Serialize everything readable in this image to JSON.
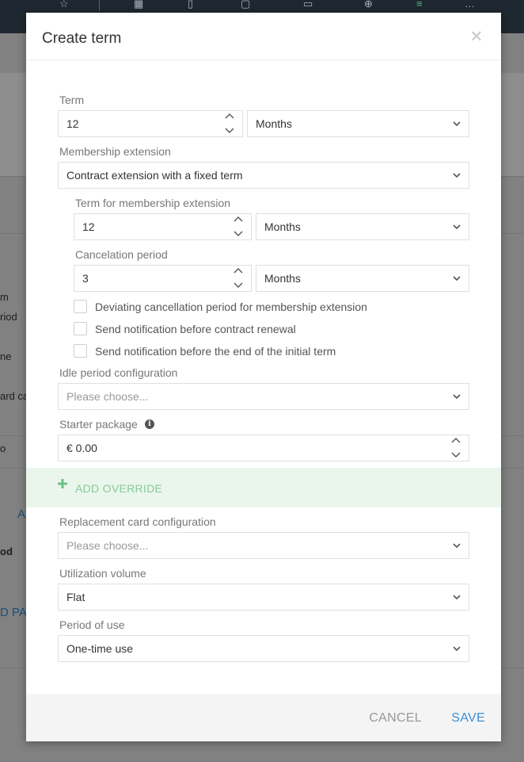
{
  "background": {
    "left_texts": [
      "m",
      "riod",
      "ne",
      "ard ca",
      "o",
      "od"
    ],
    "link_a": "A",
    "link_pay": "D PAY"
  },
  "modal": {
    "title": "Create term",
    "close_icon": "×",
    "term": {
      "label": "Term",
      "value": "12",
      "unit": "Months"
    },
    "membership_extension": {
      "label": "Membership extension",
      "value": "Contract extension with a fixed term"
    },
    "term_for_extension": {
      "label": "Term for membership extension",
      "value": "12",
      "unit": "Months"
    },
    "cancelation_period": {
      "label": "Cancelation period",
      "value": "3",
      "unit": "Months"
    },
    "checkboxes": [
      {
        "label": "Deviating cancellation period for membership extension",
        "checked": false
      },
      {
        "label": "Send notification before contract renewal",
        "checked": false
      },
      {
        "label": "Send notification before the end of the initial term",
        "checked": false
      }
    ],
    "idle_period": {
      "label": "Idle period configuration",
      "placeholder": "Please choose..."
    },
    "starter_package": {
      "label": "Starter package",
      "value": "€ 0.00"
    },
    "add_override": "ADD OVERRIDE",
    "replacement_card": {
      "label": "Replacement card configuration",
      "placeholder": "Please choose..."
    },
    "utilization_volume": {
      "label": "Utilization volume",
      "value": "Flat"
    },
    "period_of_use": {
      "label": "Period of use",
      "value": "One-time use"
    },
    "footer": {
      "cancel": "CANCEL",
      "save": "SAVE"
    }
  },
  "colors": {
    "accent": "#3a90d8",
    "override_band": "#eaf6ec",
    "override_text": "#85cb97"
  }
}
